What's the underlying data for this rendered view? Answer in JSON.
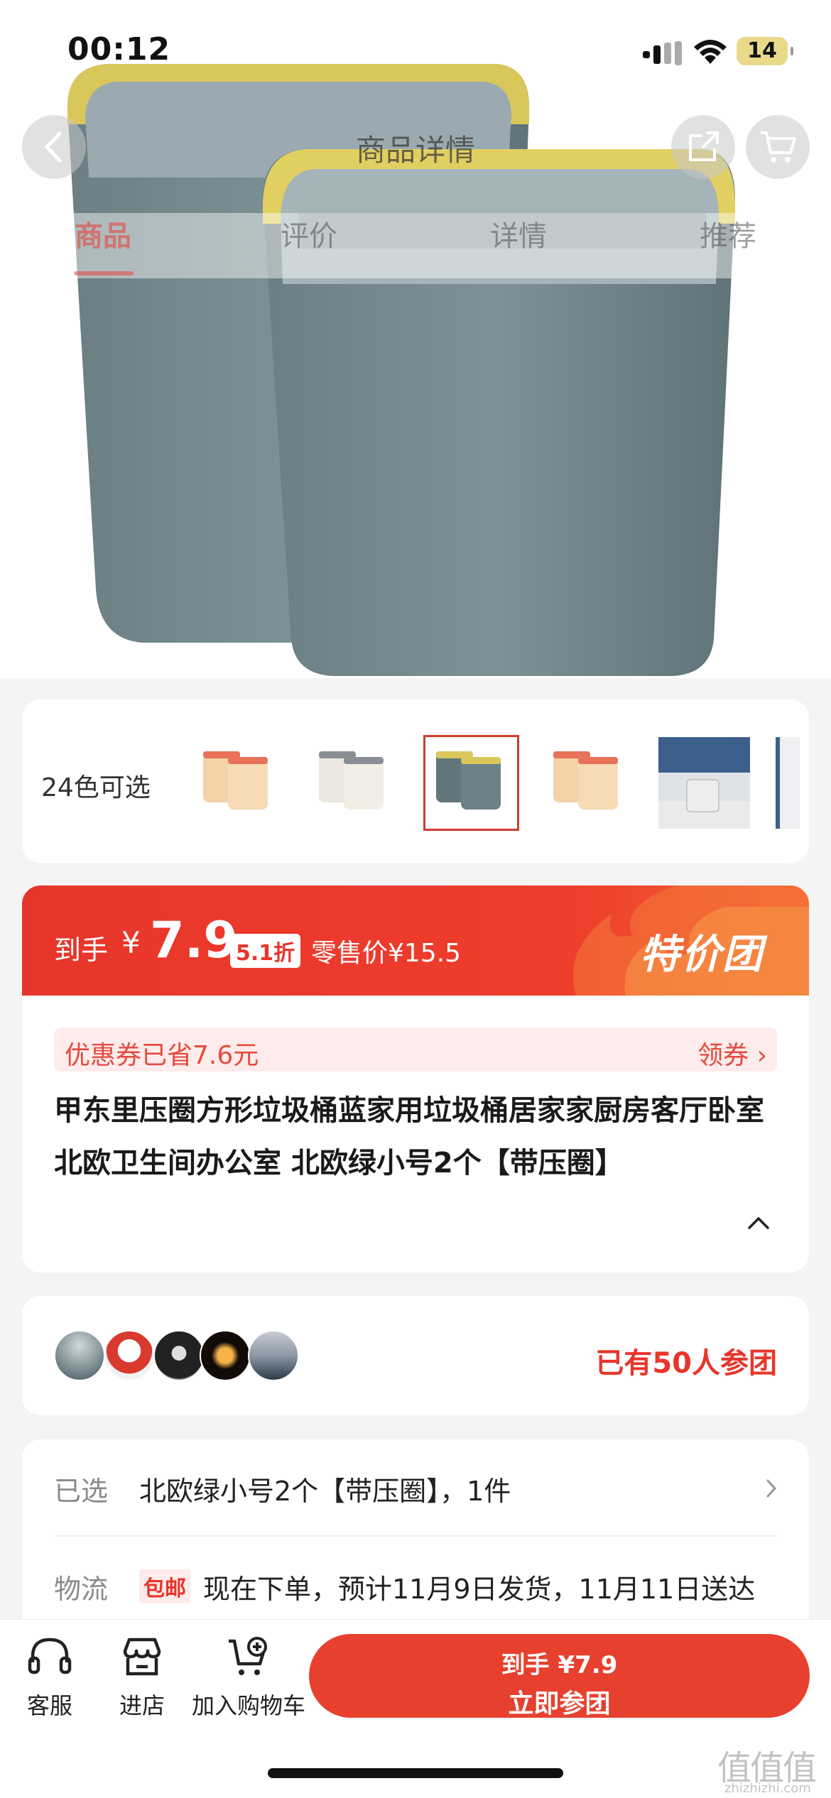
{
  "status": {
    "time": "00:12",
    "battery": "14"
  },
  "nav": {
    "title": "商品详情"
  },
  "tabs": [
    {
      "label": "商品"
    },
    {
      "label": "评价"
    },
    {
      "label": "详情"
    },
    {
      "label": "推荐"
    }
  ],
  "colors": {
    "label": "24色可选"
  },
  "price": {
    "prefix": "到手",
    "currency": "¥",
    "value": "7.9",
    "discount": "5.1折",
    "original": "零售价¥15.5",
    "badge": "特价团"
  },
  "coupon": {
    "text": "优惠券已省7.6元",
    "action": "领券"
  },
  "product": {
    "title": "甲东里压圈方形垃圾桶蓝家用垃圾桶居家家厨房客厅卧室北欧卫生间办公室 北欧绿小号2个【带压圈】"
  },
  "group": {
    "text": "已有50人参团"
  },
  "selection": {
    "selected_label": "已选",
    "selected_value": "北欧绿小号2个【带压圈】，1件",
    "shipping_label": "物流",
    "shipping_tag": "包邮",
    "shipping_value": "现在下单，预计11月9日发货，11月11日送达"
  },
  "bottom": {
    "service": "客服",
    "store": "进店",
    "cart": "加入购物车",
    "cta_price": "到手 ¥7.9",
    "cta_label": "立即参团"
  },
  "watermark": {
    "glyphs": "值值值",
    "domain": "zhizhizhi.com"
  },
  "accent": "#e8352b"
}
